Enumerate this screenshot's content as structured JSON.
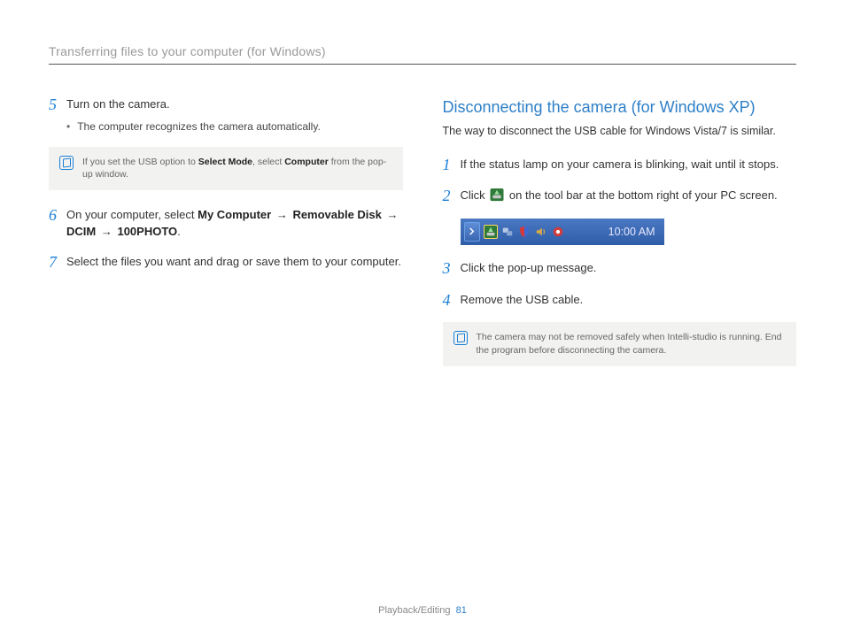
{
  "header": {
    "title": "Transferring files to your computer (for Windows)"
  },
  "left": {
    "step5": {
      "num": "5",
      "text": "Turn on the camera.",
      "bullet": "The computer recognizes the camera automatically."
    },
    "note": {
      "pre": "If you set the USB option to ",
      "b1": "Select Mode",
      "mid": ", select ",
      "b2": "Computer",
      "post": " from the pop-up window."
    },
    "step6": {
      "num": "6",
      "pre": "On your computer, select ",
      "p1": "My Computer",
      "a1": "→",
      "p2": "Removable Disk",
      "a2": "→",
      "p3": "DCIM",
      "a3": "→",
      "p4": "100PHOTO",
      "post": "."
    },
    "step7": {
      "num": "7",
      "text": "Select the files you want and drag or save them to your computer."
    }
  },
  "right": {
    "heading": "Disconnecting the camera (for Windows XP)",
    "sub": "The way to disconnect the USB cable for Windows Vista/7 is similar.",
    "step1": {
      "num": "1",
      "text": "If the status lamp on your camera is blinking, wait until it stops."
    },
    "step2": {
      "num": "2",
      "pre": "Click ",
      "post": " on the tool bar at the bottom right of your PC screen."
    },
    "taskbar": {
      "time": "10:00 AM"
    },
    "step3": {
      "num": "3",
      "text": "Click the pop-up message."
    },
    "step4": {
      "num": "4",
      "text": "Remove the USB cable."
    },
    "note2": "The camera may not be removed safely when Intelli-studio is running. End the program before disconnecting the camera."
  },
  "footer": {
    "section": "Playback/Editing",
    "page": "81"
  },
  "icons": {
    "note": "note-icon",
    "safely_remove": "safely-remove-hardware-icon",
    "tray_chevron": "chevron-right-icon"
  }
}
